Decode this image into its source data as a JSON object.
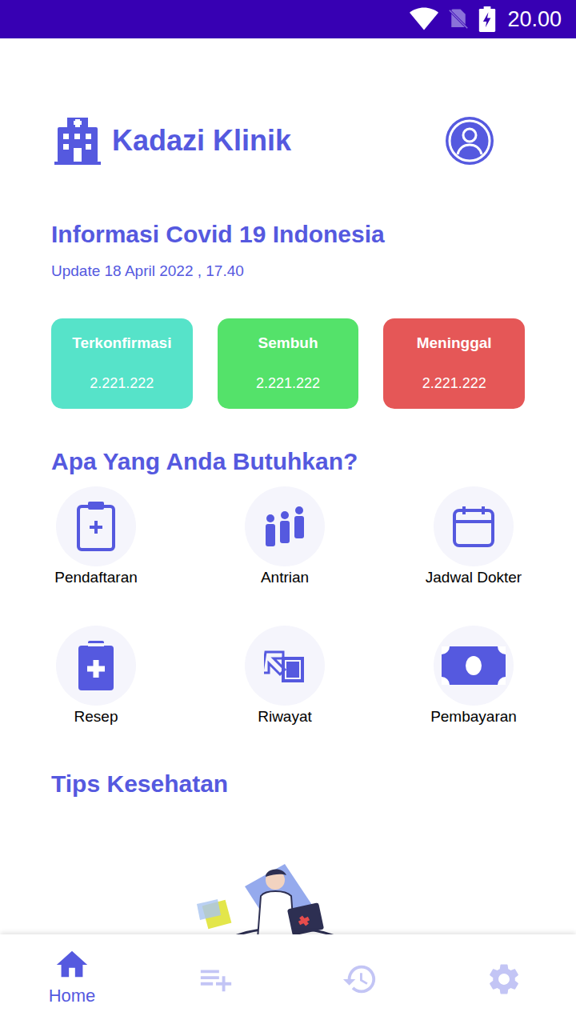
{
  "status_bar": {
    "time": "20.00"
  },
  "header": {
    "logo": "Kadazi Klinik"
  },
  "covid": {
    "title": "Informasi Covid 19 Indonesia",
    "updated": "Update 18 April 2022 , 17.40",
    "stats": [
      {
        "label": "Terkonfirmasi",
        "value": "2.221.222",
        "color": "#56e3c9"
      },
      {
        "label": "Sembuh",
        "value": "2.221.222",
        "color": "#54e26a"
      },
      {
        "label": "Meninggal",
        "value": "2.221.222",
        "color": "#e55757"
      }
    ]
  },
  "services": {
    "title": "Apa Yang Anda Butuhkan?",
    "items": [
      {
        "label": "Pendaftaran"
      },
      {
        "label": "Antrian"
      },
      {
        "label": "Jadwal Dokter"
      },
      {
        "label": "Resep"
      },
      {
        "label": "Riwayat"
      },
      {
        "label": "Pembayaran"
      }
    ]
  },
  "tips": {
    "title": "Tips Kesehatan"
  },
  "bottom_nav": [
    {
      "label": "Home",
      "selected": true
    },
    {
      "selected": false
    },
    {
      "selected": false
    },
    {
      "selected": false
    }
  ]
}
